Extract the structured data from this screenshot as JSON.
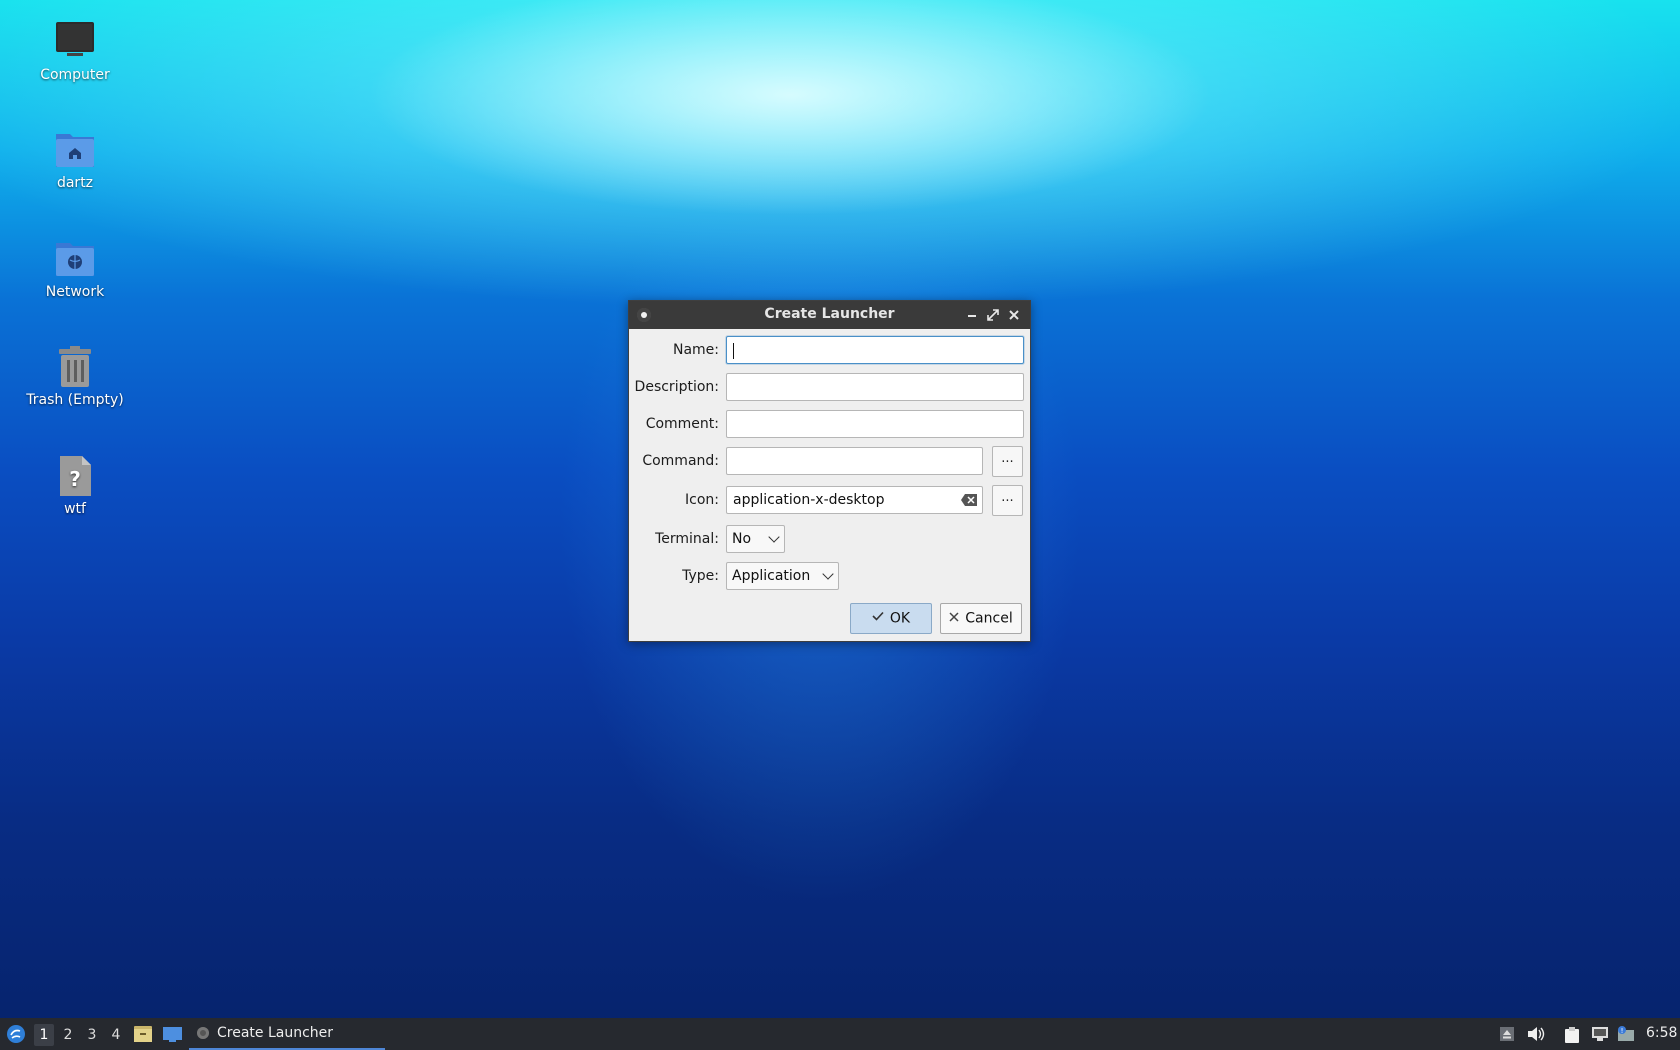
{
  "desktop": {
    "icons": [
      {
        "label": "Computer"
      },
      {
        "label": "dartz"
      },
      {
        "label": "Network"
      },
      {
        "label": "Trash (Empty)"
      },
      {
        "label": "wtf"
      }
    ]
  },
  "dialog": {
    "title": "Create Launcher",
    "fields": {
      "name": {
        "label": "Name:",
        "value": ""
      },
      "description": {
        "label": "Description:",
        "value": ""
      },
      "comment": {
        "label": "Comment:",
        "value": ""
      },
      "command": {
        "label": "Command:",
        "value": "",
        "browse_label": "..."
      },
      "icon": {
        "label": "Icon:",
        "value": "application-x-desktop",
        "browse_label": "..."
      },
      "terminal": {
        "label": "Terminal:",
        "value": "No"
      },
      "type": {
        "label": "Type:",
        "value": "Application"
      }
    },
    "ok_label": "OK",
    "cancel_label": "Cancel"
  },
  "taskbar": {
    "workspaces": [
      "1",
      "2",
      "3",
      "4"
    ],
    "active_workspace": "1",
    "task_label": "Create Launcher",
    "clock": "6:58"
  }
}
